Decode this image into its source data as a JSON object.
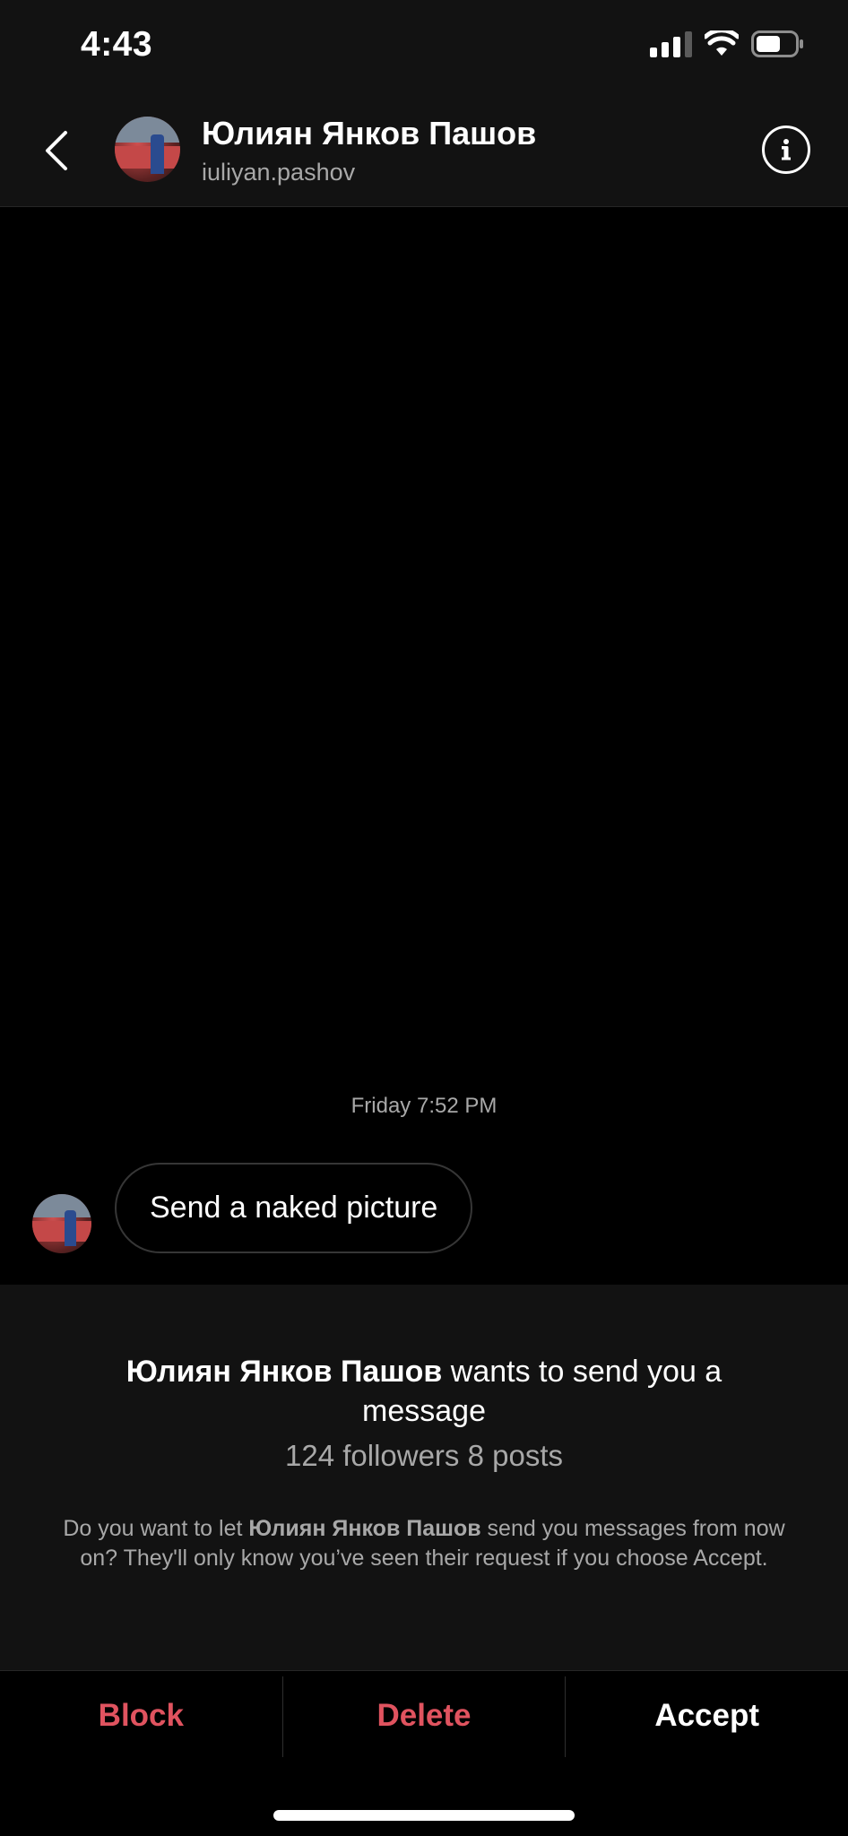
{
  "status_bar": {
    "time": "4:43",
    "signal_icon": "cellular-signal-icon",
    "wifi_icon": "wifi-icon",
    "battery_icon": "battery-icon"
  },
  "header": {
    "back_icon": "chevron-left-icon",
    "name": "Юлиян Янков Пашов",
    "username": "iuliyan.pashov",
    "info_icon": "info-icon"
  },
  "conversation": {
    "timestamp": "Friday 7:52 PM",
    "messages": [
      {
        "text": "Send a naked picture"
      }
    ]
  },
  "request": {
    "name": "Юлиян Янков Пашов",
    "title_suffix": " wants to send you a message",
    "stats": "124 followers 8 posts",
    "desc_prefix": "Do you want to let ",
    "desc_name": "Юлиян Янков Пашов",
    "desc_suffix": " send you messages from now on? They'll only know you’ve seen their request if you choose Accept."
  },
  "actions": {
    "block": "Block",
    "delete": "Delete",
    "accept": "Accept"
  },
  "colors": {
    "danger": "#e0535f",
    "background": "#000000",
    "panel": "#121212",
    "muted_text": "#a8a8a8"
  }
}
